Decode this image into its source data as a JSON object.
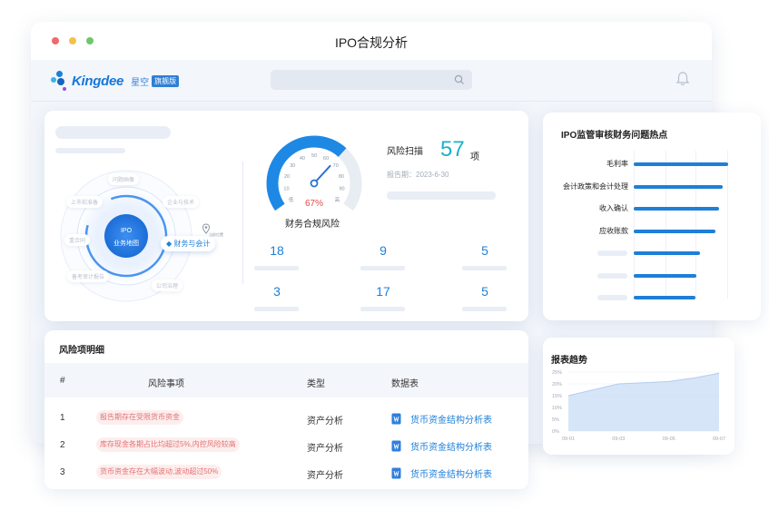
{
  "window": {
    "title": "IPO合规分析"
  },
  "header": {
    "brand": "Kingdee",
    "product": "星空",
    "edition": "旗舰版"
  },
  "diagram": {
    "center_line1": "IPO",
    "center_line2": "业务地图",
    "highlight_node": "财务与会计",
    "pin_label": "当前位置",
    "outer_nodes": [
      "问题画像",
      "上市前准备",
      "企业与技术",
      "重合同",
      "备考审计报告",
      "公司治理"
    ]
  },
  "gauge": {
    "ticks": [
      "低",
      "10",
      "20",
      "30",
      "40",
      "50",
      "60",
      "70",
      "80",
      "90",
      "高"
    ],
    "percent_text": "67%",
    "percent_value": 67,
    "caption": "财务合规风险"
  },
  "scan": {
    "label": "风险扫描",
    "count": "57",
    "unit": "项",
    "report_date": "报告期：2023-6-30"
  },
  "stats": [
    {
      "value": "18"
    },
    {
      "value": "9"
    },
    {
      "value": "5"
    },
    {
      "value": "3"
    },
    {
      "value": "17"
    },
    {
      "value": "5"
    }
  ],
  "hotspots": {
    "title": "IPO监管审核财务问题热点",
    "bars": [
      {
        "label": "毛利率",
        "value": 1.0
      },
      {
        "label": "会计政策和会计处理",
        "value": 0.94
      },
      {
        "label": "收入确认",
        "value": 0.9
      },
      {
        "label": "应收账款",
        "value": 0.87
      },
      {
        "label": "",
        "value": 0.7
      },
      {
        "label": "",
        "value": 0.66
      },
      {
        "label": "",
        "value": 0.65
      }
    ]
  },
  "risk_table": {
    "title": "风险项明细",
    "columns": [
      "#",
      "风险事项",
      "类型",
      "数据表"
    ],
    "rows": [
      {
        "idx": "1",
        "item": "报告期存在受限货币资金",
        "type": "资产分析",
        "sheet": "货币资金结构分析表"
      },
      {
        "idx": "2",
        "item": "库存现金各期占比均超过5%,内控风险较高",
        "type": "资产分析",
        "sheet": "货币资金结构分析表"
      },
      {
        "idx": "3",
        "item": "货币资金存在大幅波动,波动超过50%",
        "type": "资产分析",
        "sheet": "货币资金结构分析表"
      }
    ]
  },
  "chart_data": {
    "type": "area",
    "title": "报表趋势",
    "x": [
      "09-01",
      "09-02",
      "09-03",
      "09-04",
      "09-05",
      "09-06",
      "09-07"
    ],
    "x_tick_labels": [
      "09-01",
      "09-03",
      "09-05",
      "09-07"
    ],
    "y_tick_labels": [
      "0%",
      "5%",
      "10%",
      "15%",
      "20%",
      "25%"
    ],
    "ylim": [
      0,
      25
    ],
    "series": [
      {
        "values": [
          15,
          17.5,
          20,
          20.5,
          21,
          22.5,
          24.5
        ]
      }
    ],
    "color": "#c9dcf6"
  }
}
